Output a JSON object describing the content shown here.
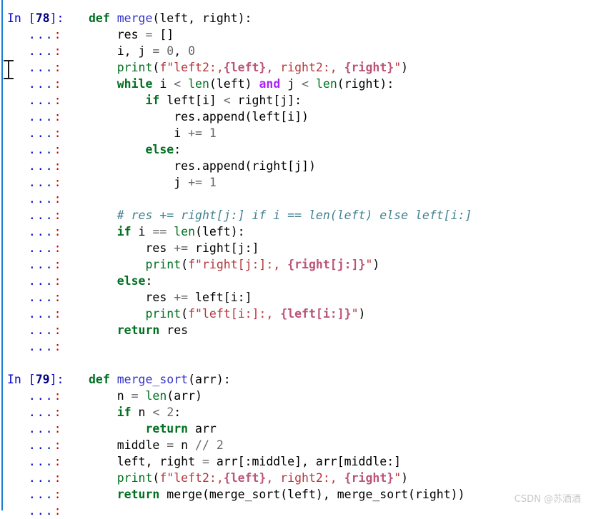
{
  "app": {
    "kind": "ipython-console",
    "background": "#ffffff",
    "stripe_color": "#1a7fd4"
  },
  "colors": {
    "keyword": "#007020",
    "operator_word": "#aa22ff",
    "function_name": "#3333cc",
    "builtin": "#007020",
    "string": "#b5363a",
    "string_placeholder": "#bb5577",
    "number": "#666666",
    "operator": "#666666",
    "comment": "#408090",
    "text": "#000000",
    "prompt_in": "#0000cc",
    "prompt_number": "#000080",
    "continuation_colon": "#cc0000",
    "watermark": "#c8c8c8"
  },
  "prompts": {
    "in_open": "In [",
    "in_close": "]:",
    "continuation_dots": "...",
    "continuation_colon": ":"
  },
  "cells": [
    {
      "number": "78",
      "lines": [
        [
          {
            "t": "def ",
            "c": "kw"
          },
          {
            "t": "merge",
            "c": "fn"
          },
          {
            "t": "(left, right):",
            "c": "txt"
          }
        ],
        [
          {
            "t": "    res ",
            "c": "txt"
          },
          {
            "t": "=",
            "c": "op"
          },
          {
            "t": " []",
            "c": "txt"
          }
        ],
        [
          {
            "t": "    i, j ",
            "c": "txt"
          },
          {
            "t": "=",
            "c": "op"
          },
          {
            "t": " ",
            "c": "txt"
          },
          {
            "t": "0",
            "c": "num"
          },
          {
            "t": ", ",
            "c": "txt"
          },
          {
            "t": "0",
            "c": "num"
          }
        ],
        [
          {
            "t": "    ",
            "c": "txt"
          },
          {
            "t": "print",
            "c": "bi"
          },
          {
            "t": "(",
            "c": "txt"
          },
          {
            "t": "f\"left2:,",
            "c": "str"
          },
          {
            "t": "{left}",
            "c": "str-ph"
          },
          {
            "t": ", right2:, ",
            "c": "str"
          },
          {
            "t": "{right}",
            "c": "str-ph"
          },
          {
            "t": "\"",
            "c": "str"
          },
          {
            "t": ")",
            "c": "txt"
          }
        ],
        [
          {
            "t": "    ",
            "c": "txt"
          },
          {
            "t": "while",
            "c": "kw"
          },
          {
            "t": " i ",
            "c": "txt"
          },
          {
            "t": "<",
            "c": "op"
          },
          {
            "t": " ",
            "c": "txt"
          },
          {
            "t": "len",
            "c": "bi"
          },
          {
            "t": "(left) ",
            "c": "txt"
          },
          {
            "t": "and",
            "c": "op-kw"
          },
          {
            "t": " j ",
            "c": "txt"
          },
          {
            "t": "<",
            "c": "op"
          },
          {
            "t": " ",
            "c": "txt"
          },
          {
            "t": "len",
            "c": "bi"
          },
          {
            "t": "(right):",
            "c": "txt"
          }
        ],
        [
          {
            "t": "        ",
            "c": "txt"
          },
          {
            "t": "if",
            "c": "kw"
          },
          {
            "t": " left[i] ",
            "c": "txt"
          },
          {
            "t": "<",
            "c": "op"
          },
          {
            "t": " right[j]:",
            "c": "txt"
          }
        ],
        [
          {
            "t": "            res.append(left[i])",
            "c": "txt"
          }
        ],
        [
          {
            "t": "            i ",
            "c": "txt"
          },
          {
            "t": "+=",
            "c": "op"
          },
          {
            "t": " ",
            "c": "txt"
          },
          {
            "t": "1",
            "c": "num"
          }
        ],
        [
          {
            "t": "        ",
            "c": "txt"
          },
          {
            "t": "else",
            "c": "kw"
          },
          {
            "t": ":",
            "c": "txt"
          }
        ],
        [
          {
            "t": "            res.append(right[j])",
            "c": "txt"
          }
        ],
        [
          {
            "t": "            j ",
            "c": "txt"
          },
          {
            "t": "+=",
            "c": "op"
          },
          {
            "t": " ",
            "c": "txt"
          },
          {
            "t": "1",
            "c": "num"
          }
        ],
        [],
        [
          {
            "t": "    ",
            "c": "txt"
          },
          {
            "t": "# res += right[j:] if i == len(left) else left[i:]",
            "c": "cm"
          }
        ],
        [
          {
            "t": "    ",
            "c": "txt"
          },
          {
            "t": "if",
            "c": "kw"
          },
          {
            "t": " i ",
            "c": "txt"
          },
          {
            "t": "==",
            "c": "op"
          },
          {
            "t": " ",
            "c": "txt"
          },
          {
            "t": "len",
            "c": "bi"
          },
          {
            "t": "(left):",
            "c": "txt"
          }
        ],
        [
          {
            "t": "        res ",
            "c": "txt"
          },
          {
            "t": "+=",
            "c": "op"
          },
          {
            "t": " right[j:]",
            "c": "txt"
          }
        ],
        [
          {
            "t": "        ",
            "c": "txt"
          },
          {
            "t": "print",
            "c": "bi"
          },
          {
            "t": "(",
            "c": "txt"
          },
          {
            "t": "f\"right[j:]:, ",
            "c": "str"
          },
          {
            "t": "{right[j:]}",
            "c": "str-ph"
          },
          {
            "t": "\"",
            "c": "str"
          },
          {
            "t": ")",
            "c": "txt"
          }
        ],
        [
          {
            "t": "    ",
            "c": "txt"
          },
          {
            "t": "else",
            "c": "kw"
          },
          {
            "t": ":",
            "c": "txt"
          }
        ],
        [
          {
            "t": "        res ",
            "c": "txt"
          },
          {
            "t": "+=",
            "c": "op"
          },
          {
            "t": " left[i:]",
            "c": "txt"
          }
        ],
        [
          {
            "t": "        ",
            "c": "txt"
          },
          {
            "t": "print",
            "c": "bi"
          },
          {
            "t": "(",
            "c": "txt"
          },
          {
            "t": "f\"left[i:]:, ",
            "c": "str"
          },
          {
            "t": "{left[i:]}",
            "c": "str-ph"
          },
          {
            "t": "\"",
            "c": "str"
          },
          {
            "t": ")",
            "c": "txt"
          }
        ],
        [
          {
            "t": "    ",
            "c": "txt"
          },
          {
            "t": "return",
            "c": "kw"
          },
          {
            "t": " res",
            "c": "txt"
          }
        ],
        []
      ]
    },
    {
      "number": "79",
      "lines": [
        [
          {
            "t": "def ",
            "c": "kw"
          },
          {
            "t": "merge_sort",
            "c": "fn"
          },
          {
            "t": "(arr):",
            "c": "txt"
          }
        ],
        [
          {
            "t": "    n ",
            "c": "txt"
          },
          {
            "t": "=",
            "c": "op"
          },
          {
            "t": " ",
            "c": "txt"
          },
          {
            "t": "len",
            "c": "bi"
          },
          {
            "t": "(arr)",
            "c": "txt"
          }
        ],
        [
          {
            "t": "    ",
            "c": "txt"
          },
          {
            "t": "if",
            "c": "kw"
          },
          {
            "t": " n ",
            "c": "txt"
          },
          {
            "t": "<",
            "c": "op"
          },
          {
            "t": " ",
            "c": "txt"
          },
          {
            "t": "2",
            "c": "num"
          },
          {
            "t": ":",
            "c": "txt"
          }
        ],
        [
          {
            "t": "        ",
            "c": "txt"
          },
          {
            "t": "return",
            "c": "kw"
          },
          {
            "t": " arr",
            "c": "txt"
          }
        ],
        [
          {
            "t": "    middle ",
            "c": "txt"
          },
          {
            "t": "=",
            "c": "op"
          },
          {
            "t": " n ",
            "c": "txt"
          },
          {
            "t": "//",
            "c": "op"
          },
          {
            "t": " ",
            "c": "txt"
          },
          {
            "t": "2",
            "c": "num"
          }
        ],
        [
          {
            "t": "    left, right ",
            "c": "txt"
          },
          {
            "t": "=",
            "c": "op"
          },
          {
            "t": " arr[:middle], arr[middle:]",
            "c": "txt"
          }
        ],
        [
          {
            "t": "    ",
            "c": "txt"
          },
          {
            "t": "print",
            "c": "bi"
          },
          {
            "t": "(",
            "c": "txt"
          },
          {
            "t": "f\"left2:,",
            "c": "str"
          },
          {
            "t": "{left}",
            "c": "str-ph"
          },
          {
            "t": ", right2:, ",
            "c": "str"
          },
          {
            "t": "{right}",
            "c": "str-ph"
          },
          {
            "t": "\"",
            "c": "str"
          },
          {
            "t": ")",
            "c": "txt"
          }
        ],
        [
          {
            "t": "    ",
            "c": "txt"
          },
          {
            "t": "return",
            "c": "kw"
          },
          {
            "t": " merge(merge_sort(left), merge_sort(right))",
            "c": "txt"
          }
        ],
        []
      ]
    }
  ],
  "watermark": {
    "text": "CSDN @苏酒酒"
  }
}
